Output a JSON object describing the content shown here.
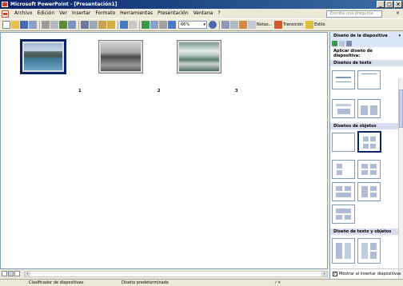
{
  "window": {
    "title": "Microsoft PowerPoint - [Presentación1]",
    "buttons": [
      "_",
      "□",
      "×"
    ]
  },
  "menu": {
    "items": [
      "Archivo",
      "Edición",
      "Ver",
      "Insertar",
      "Formato",
      "Herramientas",
      "Presentación",
      "Ventana",
      "?"
    ],
    "help_placeholder": "Escriba una pregunta",
    "doc_close": "×"
  },
  "toolbar": {
    "zoom": "66%",
    "notes_label": "Notas...",
    "transition_label": "Transición",
    "style_label": "Estilo"
  },
  "slides": [
    {
      "number": "1",
      "selected": true
    },
    {
      "number": "2",
      "selected": false
    },
    {
      "number": "3",
      "selected": false
    }
  ],
  "taskpane": {
    "title": "Diseño de la diapositiva",
    "menu_arrow": "▾",
    "subtitle": "Aplicar diseño de diapositiva:",
    "sections": [
      "Diseños de texto",
      "Diseños de objetos",
      "Diseño de texto y objetos"
    ],
    "show_on_insert": "Mostrar al insertar diapositivas",
    "checkbox": "✓"
  },
  "statusbar": {
    "view": "Clasificador de diapositivas",
    "design": "Diseño predeterminado"
  },
  "colors": {
    "title_start": "#0a246a",
    "title_end": "#3a6ea5",
    "pane_header": "#dbe6f8",
    "selection": "#0a246a"
  },
  "icons": [
    "new-icon",
    "open-icon",
    "save-icon",
    "print-icon",
    "spell-icon",
    "cut-icon",
    "copy-icon",
    "paste-icon",
    "undo-icon",
    "redo-icon",
    "chart-icon",
    "help-icon",
    "notes-icon",
    "transition-icon",
    "style-icon"
  ]
}
